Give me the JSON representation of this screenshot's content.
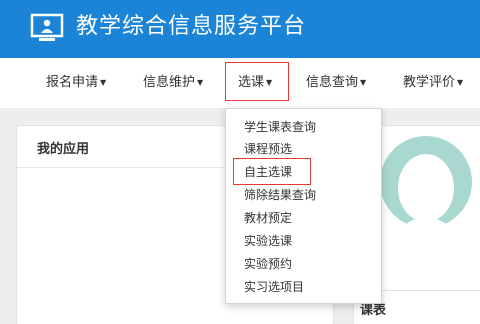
{
  "header": {
    "title": "教学综合信息服务平台",
    "logo_icon": "screen-with-person-icon",
    "background_color": "#1b84d6"
  },
  "nav": {
    "items": [
      {
        "label": "报名申请"
      },
      {
        "label": "信息维护"
      },
      {
        "label": "选课",
        "active": true
      },
      {
        "label": "信息查询"
      },
      {
        "label": "教学评价"
      }
    ]
  },
  "dropdown": {
    "items": [
      {
        "label": "学生课表查询"
      },
      {
        "label": "课程预选"
      },
      {
        "label": "自主选课",
        "highlighted": true
      },
      {
        "label": "筛除结果查询"
      },
      {
        "label": "教材预定"
      },
      {
        "label": "实验选课"
      },
      {
        "label": "实验预约"
      },
      {
        "label": "实习选项目"
      }
    ]
  },
  "panels": {
    "apps_title": "我的应用",
    "course_title": "课表"
  },
  "colors": {
    "highlight_border": "#e53935",
    "avatar_color": "#a8d8cf"
  }
}
